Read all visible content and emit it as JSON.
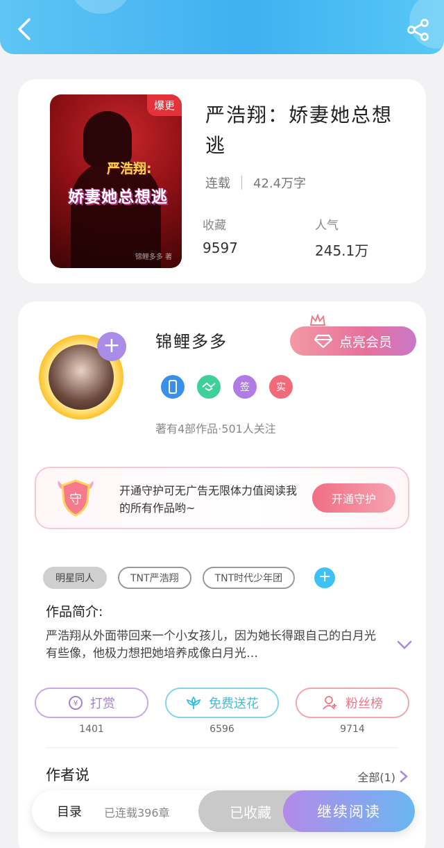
{
  "header": {
    "back_icon": "chevron-left-icon",
    "share_icon": "share-icon",
    "bg_color": "#4cb9f3"
  },
  "book": {
    "badge": "爆更",
    "cover_title_small": "严浩翔:",
    "cover_title_big": "娇妻她总想逃",
    "cover_signature": "锦鲤多多 著",
    "title": "严浩翔：娇妻她总想逃",
    "status": "连载",
    "word_count": "42.4万字",
    "favorites_label": "收藏",
    "favorites_value": "9597",
    "popularity_label": "人气",
    "popularity_value": "245.1万"
  },
  "author": {
    "name": "锦鲤多多",
    "vip_button": "点亮会员",
    "badges": [
      {
        "icon": "phone-badge-icon",
        "text": "",
        "color": "#3a8fe8"
      },
      {
        "icon": "handshake-badge-icon",
        "text": "",
        "color": "#3fcf9a"
      },
      {
        "icon": "sign-badge-icon",
        "text": "签",
        "color": "#b07be6"
      },
      {
        "icon": "real-badge-icon",
        "text": "实",
        "color": "#f06a7a"
      }
    ],
    "stats": "著有4部作品·501人关注"
  },
  "protect": {
    "text": "开通守护可无广告无限体力值阅读我的所有作品哟~",
    "button": "开通守护",
    "shield_text": "守"
  },
  "tags": [
    "明星同人",
    "TNT严浩翔",
    "TNT时代少年团"
  ],
  "intro": {
    "label": "作品简介:",
    "text": "严浩翔从外面带回来一个小女孩儿，因为她长得跟自己的白月光有些像，他极力想把她培养成像白月光…"
  },
  "actions": [
    {
      "label": "打赏",
      "count": "1401",
      "icon": "coin-icon",
      "color": "#b28ad9"
    },
    {
      "label": "免费送花",
      "count": "6596",
      "icon": "flower-icon",
      "color": "#3fc3e6"
    },
    {
      "label": "粉丝榜",
      "count": "9714",
      "icon": "fans-icon",
      "color": "#f07a86"
    }
  ],
  "author_says": {
    "label": "作者说",
    "all": "全部(1)"
  },
  "bottom": {
    "toc": "目录",
    "chapters": "已连载396章",
    "collected": "已收藏",
    "continue": "继续阅读"
  }
}
